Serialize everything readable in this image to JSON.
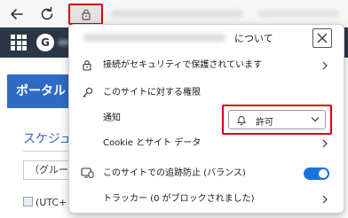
{
  "browser": {
    "back_icon": "arrow-left-icon",
    "reload_icon": "reload-icon",
    "lock_icon": "lock-icon"
  },
  "page": {
    "avatar_letter": "G",
    "portal_label": "ポータル",
    "schedule_label": "スケジュ",
    "group_select": "（グループ",
    "timezone_text": "(UTC+",
    "brand_color": "#2b3648",
    "accent_color": "#2f6bc5"
  },
  "popup": {
    "title": "について",
    "close_icon": "close-icon",
    "connection_label": "接続がセキュリティで保護されています",
    "permissions_heading": "このサイトに対する権限",
    "notification_label": "通知",
    "notification_value": "許可",
    "cookie_label": "Cookie とサイト データ",
    "tracking_label": "このサイトでの追跡防止 (バランス)",
    "tracking_enabled": true,
    "trackers_label": "トラッカー (0 がブロックされました)",
    "highlight_color": "#d7000f",
    "toggle_color": "#1a73d9"
  }
}
